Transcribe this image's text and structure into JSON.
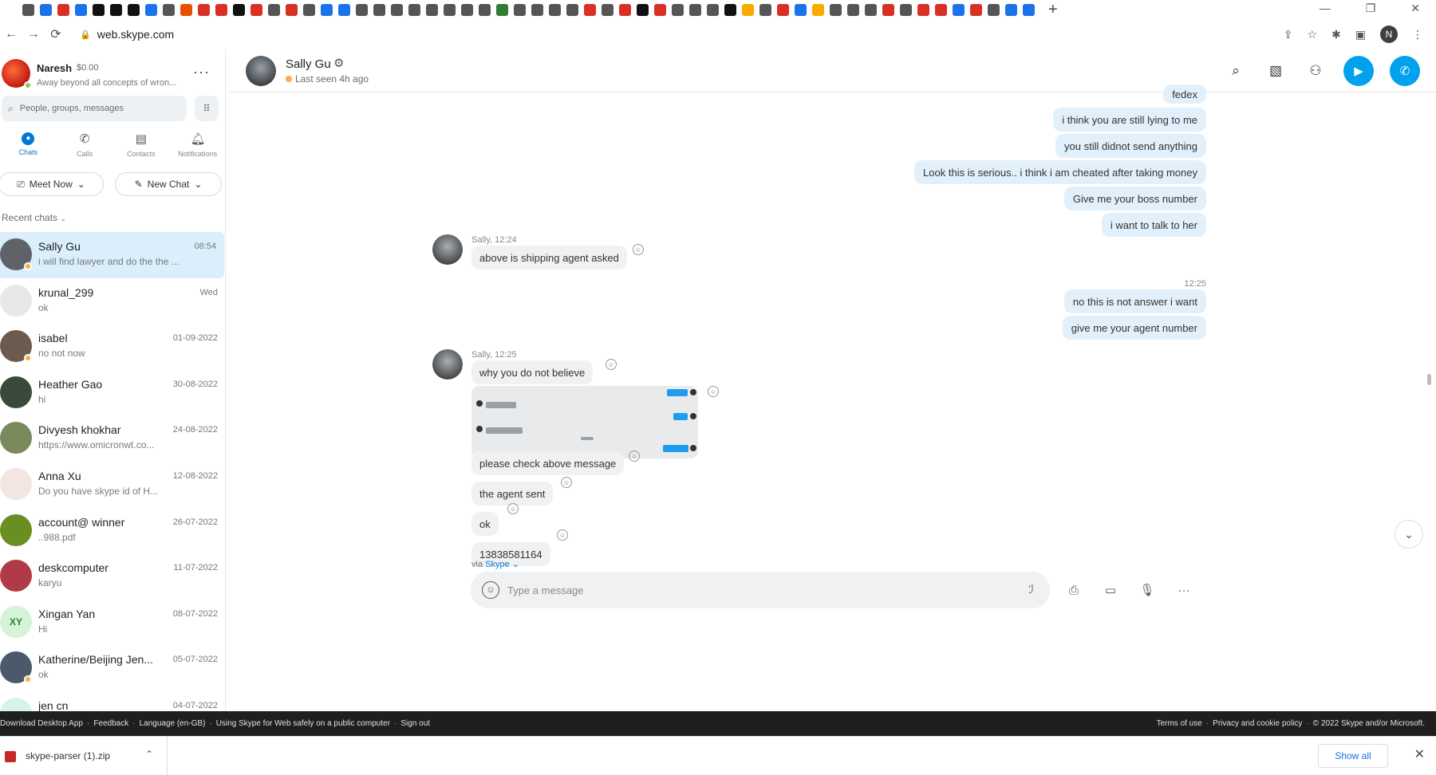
{
  "browser": {
    "url": "web.skype.com",
    "profile_initial": "N",
    "favicon_colors": [
      "#555",
      "#1a73e8",
      "#d93025",
      "#1a73e8",
      "#111",
      "#111",
      "#111",
      "#1a73e8",
      "#555",
      "#e65100",
      "#d93025",
      "#d93025",
      "#111",
      "#d93025",
      "#555",
      "#d93025",
      "#555",
      "#1a73e8",
      "#1a73e8",
      "#555",
      "#555",
      "#555",
      "#555",
      "#555",
      "#555",
      "#555",
      "#555",
      "#2e7d32",
      "#555",
      "#555",
      "#555",
      "#555",
      "#d93025",
      "#555",
      "#d93025",
      "#111",
      "#d93025",
      "#555",
      "#555",
      "#555",
      "#111",
      "#f9ab00",
      "#555",
      "#d93025",
      "#1a73e8",
      "#f9ab00",
      "#555",
      "#555",
      "#555",
      "#d93025",
      "#555",
      "#d93025",
      "#d93025",
      "#1a73e8",
      "#d93025",
      "#555",
      "#1a73e8",
      "#1a73e8"
    ]
  },
  "me": {
    "name": "Naresh",
    "credit": "$0.00",
    "mood": "Away beyond all concepts of wron..."
  },
  "search": {
    "placeholder": "People, groups, messages"
  },
  "nav_tabs": [
    {
      "label": "Chats",
      "icon": "chat-icon"
    },
    {
      "label": "Calls",
      "icon": "phone-icon"
    },
    {
      "label": "Contacts",
      "icon": "contacts-icon"
    },
    {
      "label": "Notifications",
      "icon": "bell-icon"
    }
  ],
  "actions": {
    "meet_now": "Meet Now",
    "new_chat": "New Chat"
  },
  "recent_chats_label": "Recent chats",
  "chats": [
    {
      "name": "Sally Gu",
      "time": "08:54",
      "preview": "i will find lawyer and do the the ...",
      "avatar_color": "#5f6368"
    },
    {
      "name": "krunal_299",
      "time": "Wed",
      "preview": "ok",
      "avatar_color": "#e8e8e8"
    },
    {
      "name": "isabel",
      "time": "01-09-2022",
      "preview": "no not now",
      "avatar_color": "#6d5a4e"
    },
    {
      "name": "Heather Gao",
      "time": "30-08-2022",
      "preview": "hi",
      "avatar_color": "#3a4a3a"
    },
    {
      "name": "Divyesh khokhar",
      "time": "24-08-2022",
      "preview": "https://www.omicronwt.co...",
      "avatar_color": "#7a8a5a"
    },
    {
      "name": "Anna Xu",
      "time": "12-08-2022",
      "preview": "Do you have skype id of H...",
      "avatar_color": "#f3e6e1"
    },
    {
      "name": "account@ winner",
      "time": "26-07-2022",
      "preview": "..988.pdf",
      "avatar_color": "#6b8e23"
    },
    {
      "name": "deskcomputer",
      "time": "11-07-2022",
      "preview": "karyu",
      "avatar_color": "#b03a48"
    },
    {
      "name": "Xingan  Yan",
      "time": "08-07-2022",
      "preview": "Hi",
      "initials": "XY"
    },
    {
      "name": "Katherine/Beijing Jen...",
      "time": "05-07-2022",
      "preview": "ok",
      "avatar_color": "#4a5a6a"
    },
    {
      "name": "jen cn",
      "time": "04-07-2022",
      "preview": "",
      "avatar_color": "#d5f3e7"
    }
  ],
  "conversation": {
    "name": "Sally Gu",
    "status": "Last seen 4h ago",
    "out_top": [
      "fedex",
      "i think you are still lying to me",
      "you still didnot send anything",
      "Look this is serious.. i think i am cheated after taking money",
      "Give me your boss number",
      "i want to talk to her"
    ],
    "in_group1_meta": "Sally, 12:24",
    "in_group1": [
      "above is shipping agent asked"
    ],
    "out_time": "12:25",
    "out_mid": [
      "no this is not answer i want",
      "give me your agent number"
    ],
    "in_group2_meta": "Sally, 12:25",
    "in_group2_first": "why you do not believe",
    "in_group2_rest": [
      "please check above message",
      "the agent sent",
      "ok",
      "13838581164"
    ],
    "via_label": "via",
    "via_app": "Skype"
  },
  "composer": {
    "placeholder": "Type a message"
  },
  "footer": {
    "left": [
      "Download Desktop App",
      "Feedback",
      "Language (en-GB)",
      "Using Skype for Web safely on a public computer",
      "Sign out"
    ],
    "right": [
      "Terms of use",
      "Privacy and cookie policy",
      "© 2022 Skype and/or Microsoft."
    ]
  },
  "downloads": {
    "file": "skype-parser (1).zip",
    "show_all": "Show all"
  },
  "colors": {
    "accent": "#0078d4",
    "call_blue": "#00a2ed",
    "out_bubble": "#e1f0fb",
    "selected_row": "#daeefc"
  }
}
